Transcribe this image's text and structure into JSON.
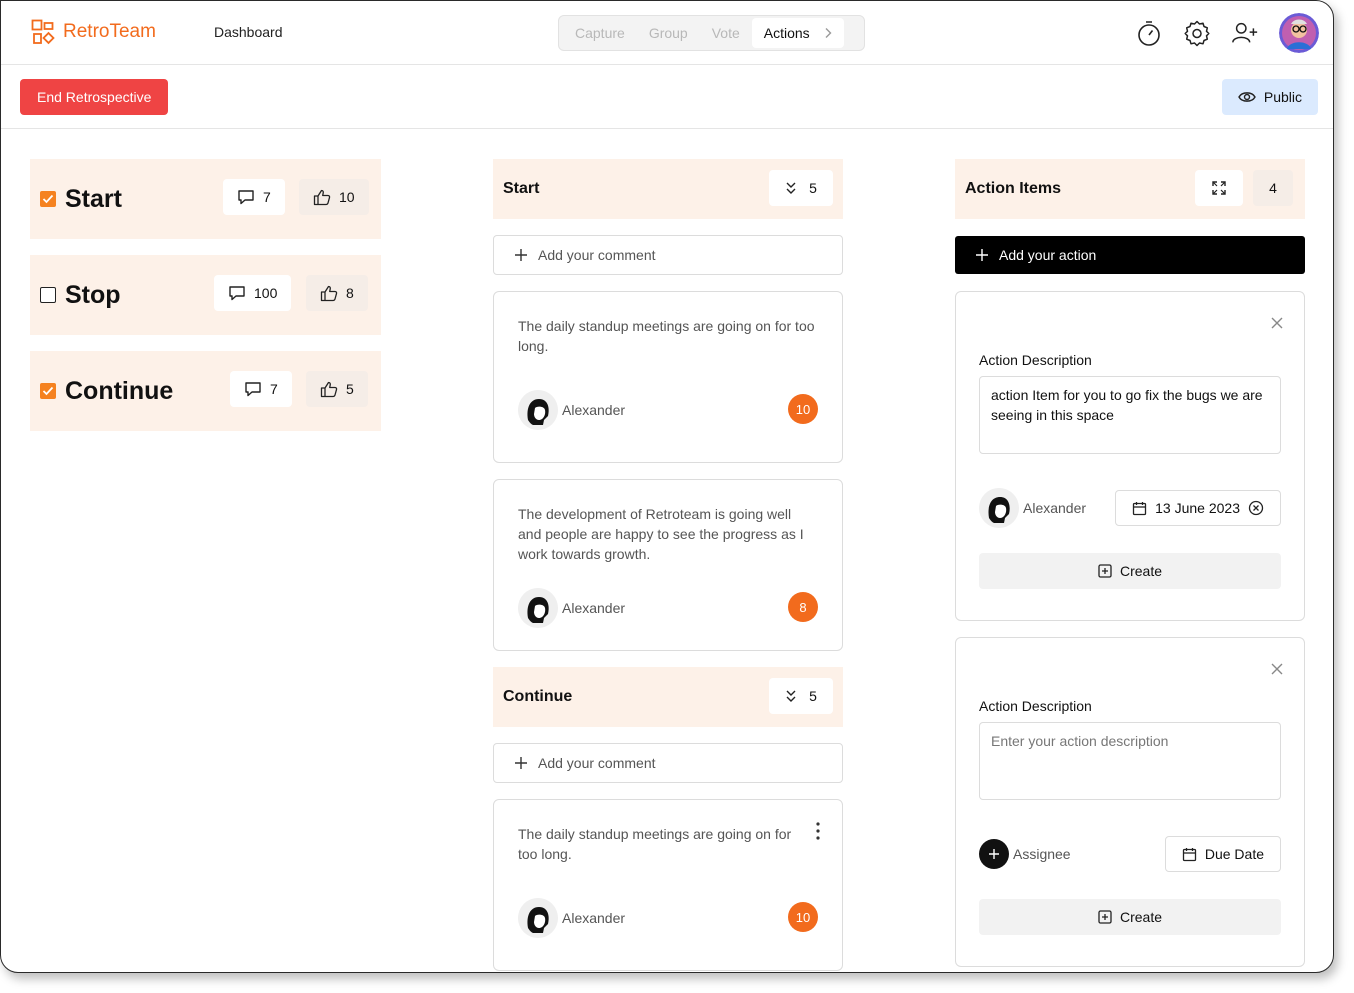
{
  "app": {
    "name": "RetroTeam",
    "nav_dashboard": "Dashboard"
  },
  "stepper": {
    "steps": [
      "Capture",
      "Group",
      "Vote",
      "Actions"
    ],
    "active": "Actions"
  },
  "subbar": {
    "end_label": "End Retrospective",
    "public_label": "Public"
  },
  "categories": [
    {
      "title": "Start",
      "checked": true,
      "comments": "7",
      "votes": "10"
    },
    {
      "title": "Stop",
      "checked": false,
      "comments": "100",
      "votes": "8"
    },
    {
      "title": "Continue",
      "checked": true,
      "comments": "7",
      "votes": "5"
    }
  ],
  "middle": {
    "start": {
      "title": "Start",
      "count": "5",
      "add_label": "Add your comment",
      "cards": [
        {
          "text": "The daily standup meetings are going on for too long.",
          "author": "Alexander",
          "votes": "10"
        },
        {
          "text": "The development of Retroteam is going well and people are happy to see the progress as I work towards growth.",
          "author": "Alexander",
          "votes": "8"
        }
      ]
    },
    "continue": {
      "title": "Continue",
      "count": "5",
      "add_label": "Add your comment",
      "cards": [
        {
          "text": "The daily standup meetings are going on for too long.",
          "author": "Alexander",
          "votes": "10"
        }
      ]
    }
  },
  "actions": {
    "title": "Action Items",
    "count": "4",
    "add_label": "Add your action",
    "items": [
      {
        "label": "Action  Description",
        "value": "action Item for you to go fix the bugs we are seeing in this space",
        "assignee": "Alexander",
        "due": "13 June 2023",
        "create_label": "Create"
      },
      {
        "label": "Action  Description",
        "placeholder": "Enter your action description",
        "assignee": "Assignee",
        "due": "Due Date",
        "create_label": "Create"
      }
    ]
  },
  "colors": {
    "brand": "#f26b1d",
    "danger": "#ef4444",
    "category_bg": "#fdf1e8",
    "public_bg": "#dbeafe"
  }
}
